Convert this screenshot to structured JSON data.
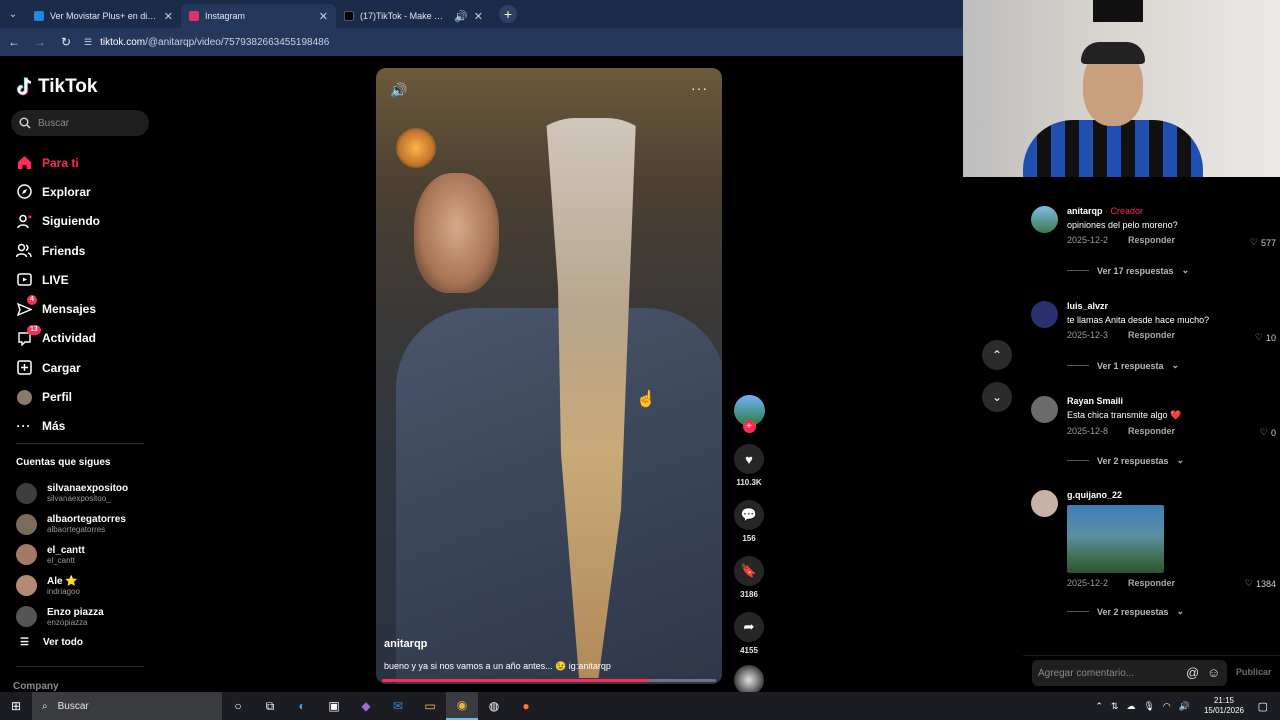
{
  "browser": {
    "tabs": [
      {
        "title": "Ver Movistar Plus+ en dispositi",
        "favicon_color": "#1e88e5",
        "active": false
      },
      {
        "title": "Instagram",
        "favicon_color": "#e1306c",
        "active": true
      },
      {
        "title": "(17)TikTok - Make Your Day",
        "favicon_color": "#000000",
        "active": false
      }
    ],
    "new_tab": "+",
    "url_domain": "tiktok.com",
    "url_path": "/@anitarqp/video/7579382663455198486"
  },
  "sidebar": {
    "logo": "TikTok",
    "search_placeholder": "Buscar",
    "nav": [
      {
        "label": "Para ti",
        "icon": "home-icon",
        "active": true
      },
      {
        "label": "Explorar",
        "icon": "compass-icon"
      },
      {
        "label": "Siguiendo",
        "icon": "following-icon"
      },
      {
        "label": "Friends",
        "icon": "friends-icon"
      },
      {
        "label": "LIVE",
        "icon": "live-icon"
      },
      {
        "label": "Mensajes",
        "icon": "messages-icon",
        "badge": "4"
      },
      {
        "label": "Actividad",
        "icon": "activity-icon",
        "badge": "13"
      },
      {
        "label": "Cargar",
        "icon": "upload-icon"
      },
      {
        "label": "Perfil",
        "icon": "profile-icon"
      },
      {
        "label": "Más",
        "icon": "more-icon"
      }
    ],
    "following_title": "Cuentas que sigues",
    "following": [
      {
        "name": "silvanaexpositoo",
        "user": "silvanaexpositoo_"
      },
      {
        "name": "albaortegatorres",
        "user": "albaortegatorres"
      },
      {
        "name": "el_cantt",
        "user": "el_cantt"
      },
      {
        "name": "Ale ⭐",
        "user": "indriagoo"
      },
      {
        "name": "Enzo piazza",
        "user": "enzopiazza"
      }
    ],
    "see_all": "Ver todo",
    "company": "Company"
  },
  "video": {
    "author": "anitarqp",
    "caption": "bueno y ya si nos vamos a un año antes... 😉 ig:anitarqp",
    "progress": 0.8
  },
  "actions": {
    "likes": "110.3K",
    "comments": "156",
    "saves": "3186",
    "shares": "4155"
  },
  "comments": [
    {
      "user": "anitarqp",
      "creator_tag": "· Creador",
      "text": "opiniones del pelo moreno?",
      "date": "2025-12-2",
      "reply": "Responder",
      "likes": "577",
      "more": "Ver 17 respuestas"
    },
    {
      "user": "luis_alvzr",
      "text": "te llamas Anita desde hace mucho?",
      "date": "2025-12-3",
      "reply": "Responder",
      "likes": "10",
      "more": "Ver 1 respuesta"
    },
    {
      "user": "Rayan Smaili",
      "text": "Esta chica transmite algo ❤️",
      "date": "2025-12-8",
      "reply": "Responder",
      "likes": "0",
      "more": "Ver 2 respuestas"
    },
    {
      "user": "g.quijano_22",
      "text": "",
      "date": "2025-12-2",
      "reply": "Responder",
      "likes": "1384",
      "more": "Ver 2 respuestas"
    }
  ],
  "comment_input": {
    "placeholder": "Agregar comentario...",
    "publish": "Publicar"
  },
  "taskbar": {
    "search": "Buscar",
    "time": "21:15",
    "date": "15/01/2026"
  }
}
